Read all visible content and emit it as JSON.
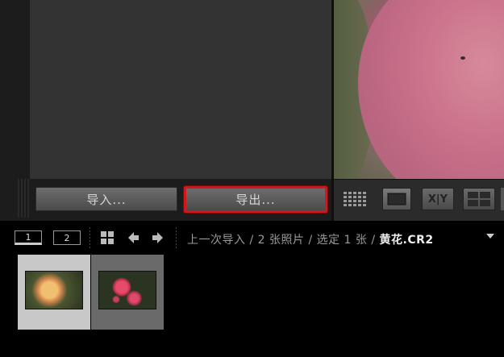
{
  "panel": {
    "import_label": "导入...",
    "export_label": "导出..."
  },
  "toolbar": {
    "grid_icon": "grid-view-icon",
    "loupe_icon": "loupe-view-icon",
    "compare_label": "X|Y",
    "survey_icon": "survey-view-icon"
  },
  "filmstrip": {
    "screen_1": "1",
    "screen_2": "2",
    "breadcrumb_source": "上一次导入",
    "breadcrumb_count": "2 张照片",
    "breadcrumb_selected": "选定 1 张",
    "breadcrumb_separator": "/",
    "current_file": "黄花.CR2",
    "thumbnails": [
      {
        "name": "yellow-rose-thumbnail",
        "selected": true
      },
      {
        "name": "pink-flowers-thumbnail",
        "selected": false
      }
    ]
  },
  "colors": {
    "export_highlight": "#d4151a",
    "background": "#000000"
  }
}
